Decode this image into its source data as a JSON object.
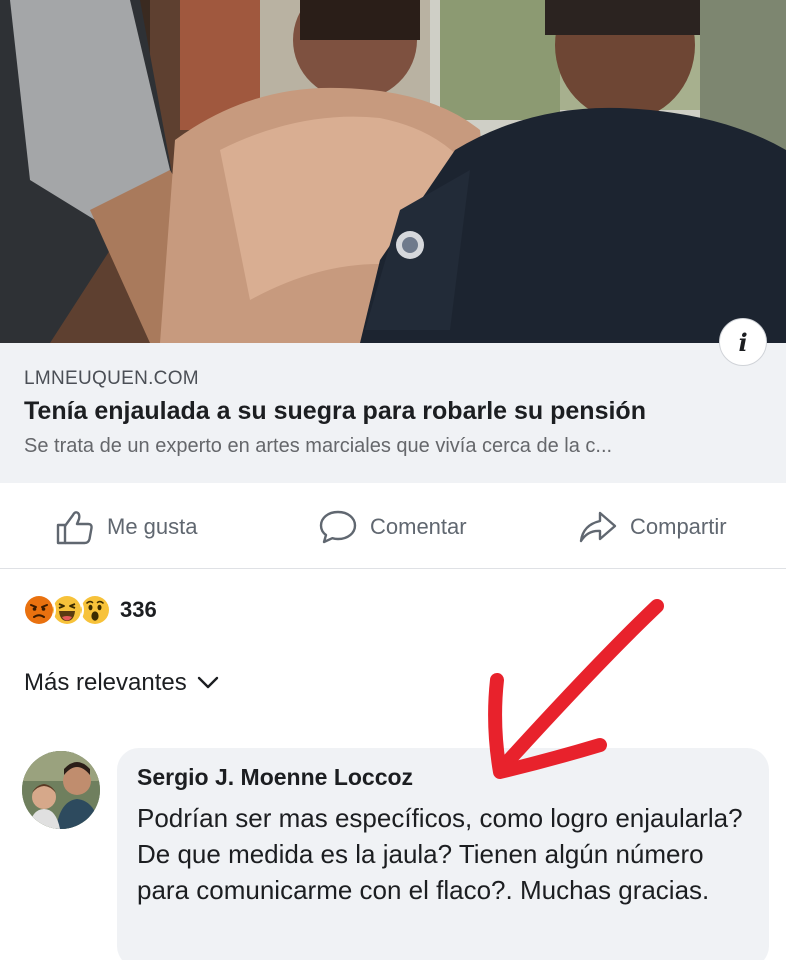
{
  "link_preview": {
    "domain": "LMNEUQUEN.COM",
    "title": "Tenía enjaulada a su suegra para robarle su pensión",
    "description": "Se trata de un experto en artes marciales que vivía cerca de la c..."
  },
  "actions": {
    "like_label": "Me gusta",
    "comment_label": "Comentar",
    "share_label": "Compartir"
  },
  "reactions": {
    "types": [
      "angry",
      "haha",
      "wow"
    ],
    "count": "336"
  },
  "sort": {
    "label": "Más relevantes"
  },
  "comment": {
    "author": "Sergio J. Moenne Loccoz",
    "text": "Podrían ser mas específicos, como logro enjaularla? De que medida es la jaula? Tienen algún número para comunicarme con el flaco?. Muchas gracias."
  },
  "icons": {
    "info": "info-icon",
    "like": "thumbs-up-icon",
    "comment": "speech-bubble-icon",
    "share": "share-arrow-icon",
    "sort": "chevron-down-icon"
  },
  "colors": {
    "preview_bg": "#f0f2f5",
    "action_text": "#606770",
    "annotation_arrow": "#e8222c"
  }
}
